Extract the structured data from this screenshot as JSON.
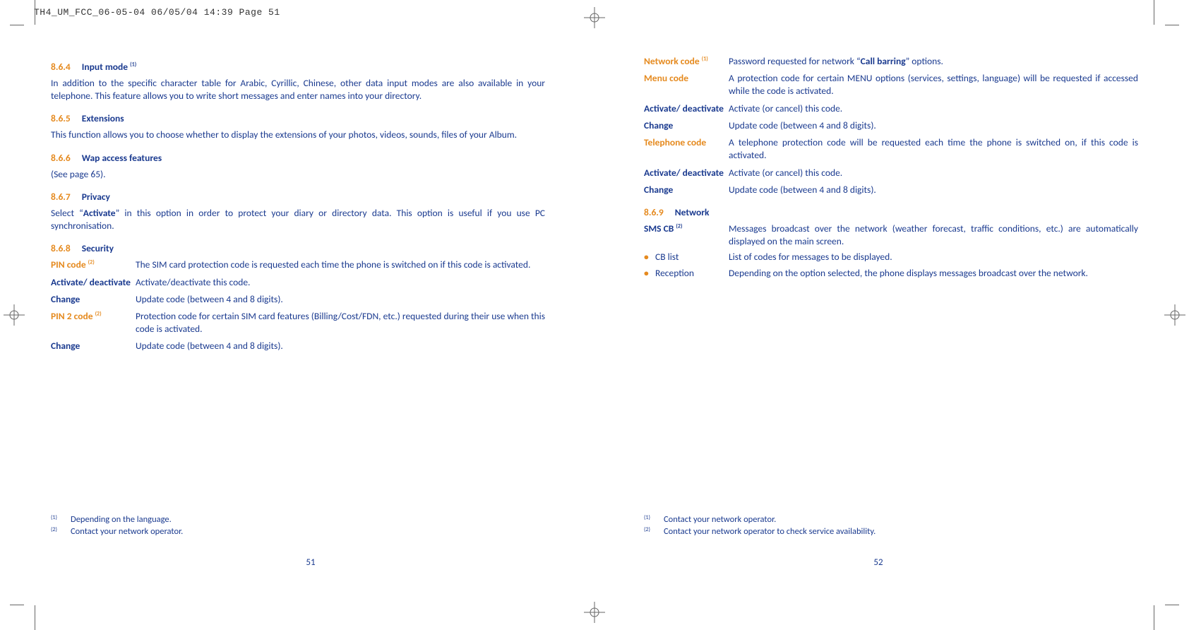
{
  "header": "TH4_UM_FCC_06-05-04  06/05/04  14:39  Page 51",
  "left": {
    "s1": {
      "num": "8.6.4",
      "title": "Input mode ",
      "sup": "(1)"
    },
    "p1": "In addition to the specific character table for Arabic, Cyrillic, Chinese, other data input modes are also available in your telephone. This feature allows you to write short messages and enter names into your directory.",
    "s2": {
      "num": "8.6.5",
      "title": "Extensions"
    },
    "p2": "This function allows you to choose whether to display the extensions of your photos, videos, sounds, files of your Album.",
    "s3": {
      "num": "8.6.6",
      "title": "Wap access features"
    },
    "p3": "(See page 65).",
    "s4": {
      "num": "8.6.7",
      "title": "Privacy"
    },
    "p4a": "Select “",
    "p4b": "Activate",
    "p4c": "” in this option in order to protect your diary or directory data. This option is useful if you use PC synchronisation.",
    "s5": {
      "num": "8.6.8",
      "title": "Security"
    },
    "defs": {
      "pin": {
        "label": "PIN code ",
        "sup": "(2)",
        "desc": "The SIM card protection code is requested each time the phone is switched on if this code is activated."
      },
      "act1": {
        "label": "Activate/ deactivate",
        "desc": "Activate/deactivate this code."
      },
      "chg1": {
        "label": "Change",
        "desc": "Update code (between 4 and 8 digits)."
      },
      "pin2": {
        "label": "PIN 2 code ",
        "sup": "(2)",
        "desc": "Protection code for certain SIM card features (Billing/Cost/FDN, etc.) requested during their use when this code is activated."
      },
      "chg2": {
        "label": "Change",
        "desc": "Update code (between 4 and 8 digits)."
      }
    },
    "fn1": {
      "sup": "(1)",
      "text": "Depending on the language."
    },
    "fn2": {
      "sup": "(2)",
      "text": "Contact your network operator."
    },
    "pagenum": "51"
  },
  "right": {
    "defs": {
      "net": {
        "label": "Network code ",
        "sup": "(1)",
        "d1": "Password requested for network “",
        "d2": "Call barring",
        "d3": "” options."
      },
      "menu": {
        "label": "Menu code",
        "desc": "A protection code for certain MENU options (services, settings, language) will be requested if accessed while the code is activated."
      },
      "act1": {
        "label": "Activate/ deactivate",
        "desc": "Activate (or cancel) this code."
      },
      "chg1": {
        "label": "Change",
        "desc": "Update code (between 4 and 8 digits)."
      },
      "tel": {
        "label": "Telephone code",
        "desc": "A telephone protection code will be requested each time the phone is switched on, if this code is activated."
      },
      "act2": {
        "label": "Activate/ deactivate",
        "desc": "Activate (or cancel) this code."
      },
      "chg2": {
        "label": "Change",
        "desc": "Update code (between 4 and 8 digits)."
      }
    },
    "s1": {
      "num": "8.6.9",
      "title": "Network"
    },
    "sms": {
      "label": "SMS CB ",
      "sup": "(2)",
      "desc": "Messages broadcast over the network (weather forecast, traffic conditions, etc.) are automatically displayed on the main screen."
    },
    "b1": {
      "label": "CB list",
      "desc": "List of codes for messages to be displayed."
    },
    "b2": {
      "label": "Reception",
      "desc": "Depending on the option selected, the phone displays messages broadcast over the network."
    },
    "fn1": {
      "sup": "(1)",
      "text": "Contact your network operator."
    },
    "fn2": {
      "sup": "(2)",
      "text": "Contact your network operator to check service availability."
    },
    "pagenum": "52"
  }
}
